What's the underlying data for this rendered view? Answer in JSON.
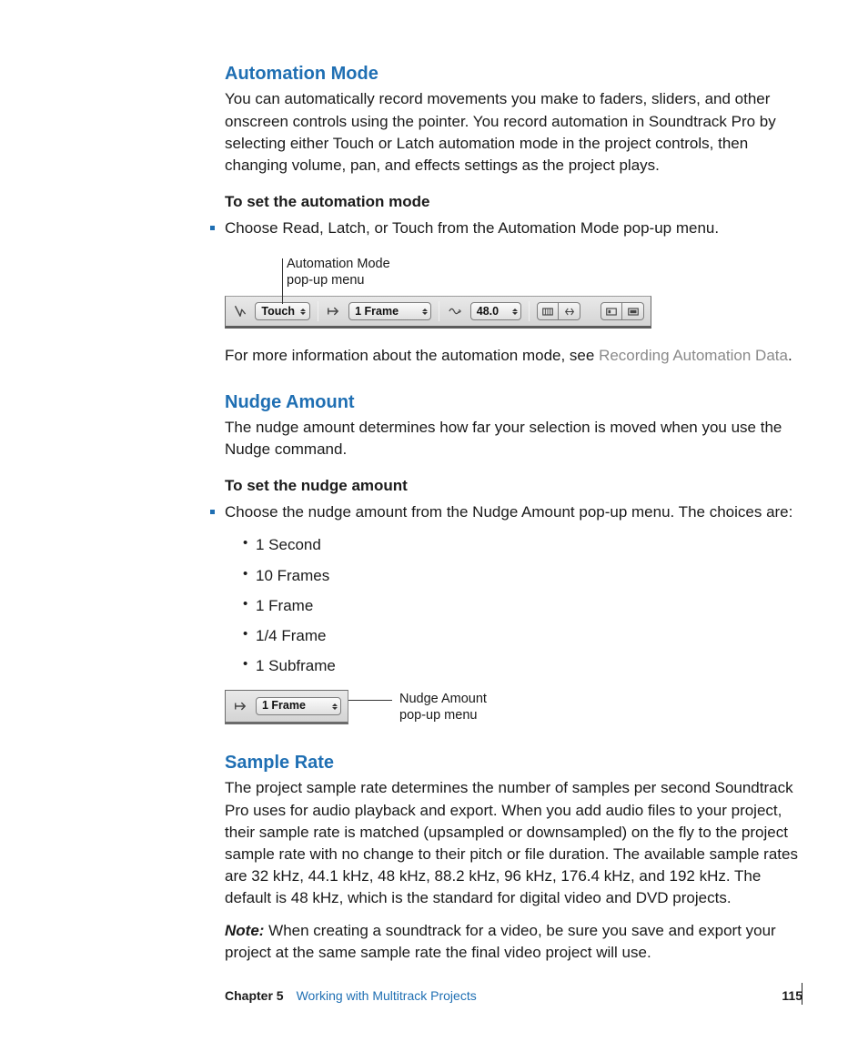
{
  "section1": {
    "heading": "Automation Mode",
    "para1": "You can automatically record movements you make to faders, sliders, and other onscreen controls using the pointer. You record automation in Soundtrack Pro by selecting either Touch or Latch automation mode in the project controls, then changing volume, pan, and effects settings as the project plays.",
    "task_heading": "To set the automation mode",
    "step1": "Choose Read, Latch, or Touch from the Automation Mode pop-up menu.",
    "callout_l1": "Automation Mode",
    "callout_l2": "pop-up menu",
    "toolbar": {
      "automation_mode": "Touch",
      "nudge": "1 Frame",
      "sample_rate": "48.0"
    },
    "post_text_a": "For more information about the automation mode, see ",
    "link_text": "Recording Automation Data",
    "post_text_b": "."
  },
  "section2": {
    "heading": "Nudge Amount",
    "para1": "The nudge amount determines how far your selection is moved when you use the Nudge command.",
    "task_heading": "To set the nudge amount",
    "step1": "Choose the nudge amount from the Nudge Amount pop-up menu. The choices are:",
    "options": {
      "o1": "1 Second",
      "o2": "10 Frames",
      "o3": "1 Frame",
      "o4": "1/4 Frame",
      "o5": "1 Subframe"
    },
    "callout_l1": "Nudge Amount",
    "callout_l2": "pop-up menu",
    "popup_value": "1 Frame"
  },
  "section3": {
    "heading": "Sample Rate",
    "para1": "The project sample rate determines the number of samples per second Soundtrack Pro uses for audio playback and export. When you add audio files to your project, their sample rate is matched (upsampled or downsampled) on the fly to the project sample rate with no change to their pitch or file duration. The available sample rates are 32 kHz, 44.1 kHz, 48 kHz, 88.2 kHz, 96 kHz, 176.4 kHz, and 192 kHz. The default is 48 kHz, which is the standard for digital video and DVD projects.",
    "note_label": "Note:",
    "note_body": "  When creating a soundtrack for a video, be sure you save and export your project at the same sample rate the final video project will use."
  },
  "footer": {
    "chapter_label": "Chapter 5",
    "chapter_title": "Working with Multitrack Projects",
    "page_number": "115"
  }
}
